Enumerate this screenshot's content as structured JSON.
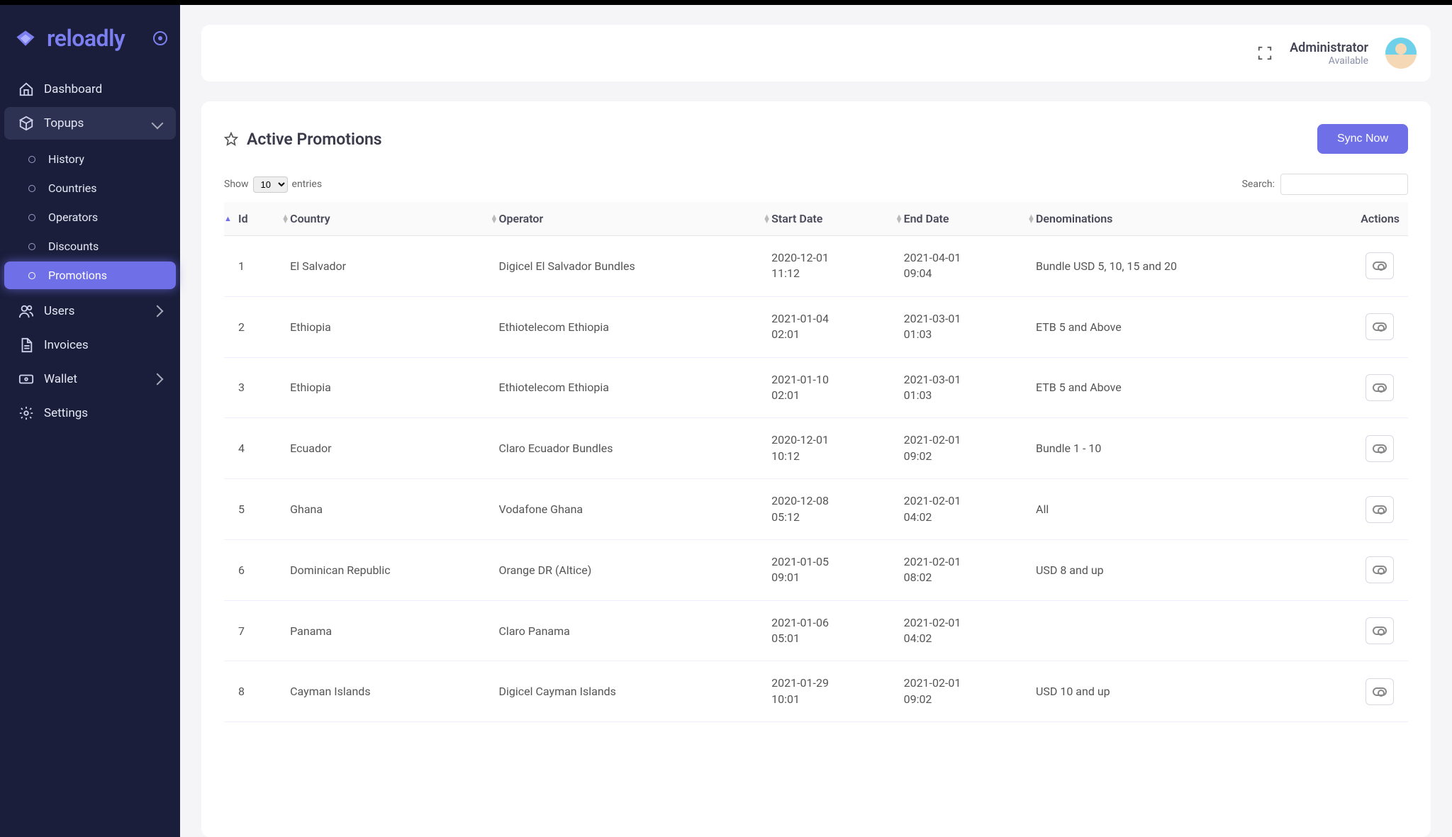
{
  "brand": {
    "name": "reloadly"
  },
  "header": {
    "user_name": "Administrator",
    "user_status": "Available"
  },
  "sidebar": {
    "items": [
      {
        "label": "Dashboard",
        "icon": "home-icon"
      },
      {
        "label": "Topups",
        "icon": "cube-icon",
        "expanded": true,
        "sub": [
          {
            "label": "History"
          },
          {
            "label": "Countries"
          },
          {
            "label": "Operators"
          },
          {
            "label": "Discounts"
          },
          {
            "label": "Promotions",
            "active": true
          }
        ]
      },
      {
        "label": "Users",
        "icon": "users-icon",
        "expandable": true
      },
      {
        "label": "Invoices",
        "icon": "document-icon"
      },
      {
        "label": "Wallet",
        "icon": "wallet-icon",
        "expandable": true
      },
      {
        "label": "Settings",
        "icon": "gear-icon"
      }
    ]
  },
  "page": {
    "title": "Active Promotions",
    "sync_button": "Sync Now"
  },
  "table_controls": {
    "show_label": "Show",
    "entries_label": "entries",
    "entries_value": "10",
    "search_label": "Search:"
  },
  "columns": [
    "Id",
    "Country",
    "Operator",
    "Start Date",
    "End Date",
    "Denominations",
    "Actions"
  ],
  "rows": [
    {
      "id": "1",
      "country": "El Salvador",
      "operator": "Digicel El Salvador Bundles",
      "start": "2020-12-01 11:12",
      "end": "2021-04-01 09:04",
      "denom": "Bundle USD 5, 10, 15 and 20"
    },
    {
      "id": "2",
      "country": "Ethiopia",
      "operator": "Ethiotelecom Ethiopia",
      "start": "2021-01-04 02:01",
      "end": "2021-03-01 01:03",
      "denom": "ETB 5 and Above"
    },
    {
      "id": "3",
      "country": "Ethiopia",
      "operator": "Ethiotelecom Ethiopia",
      "start": "2021-01-10 02:01",
      "end": "2021-03-01 01:03",
      "denom": "ETB 5 and Above"
    },
    {
      "id": "4",
      "country": "Ecuador",
      "operator": "Claro Ecuador Bundles",
      "start": "2020-12-01 10:12",
      "end": "2021-02-01 09:02",
      "denom": "Bundle 1 - 10"
    },
    {
      "id": "5",
      "country": "Ghana",
      "operator": "Vodafone Ghana",
      "start": "2020-12-08 05:12",
      "end": "2021-02-01 04:02",
      "denom": "All"
    },
    {
      "id": "6",
      "country": "Dominican Republic",
      "operator": "Orange DR (Altice)",
      "start": "2021-01-05 09:01",
      "end": "2021-02-01 08:02",
      "denom": "USD 8 and up"
    },
    {
      "id": "7",
      "country": "Panama",
      "operator": "Claro Panama",
      "start": "2021-01-06 05:01",
      "end": "2021-02-01 04:02",
      "denom": ""
    },
    {
      "id": "8",
      "country": "Cayman Islands",
      "operator": "Digicel Cayman Islands",
      "start": "2021-01-29 10:01",
      "end": "2021-02-01 09:02",
      "denom": "USD 10 and up"
    }
  ]
}
